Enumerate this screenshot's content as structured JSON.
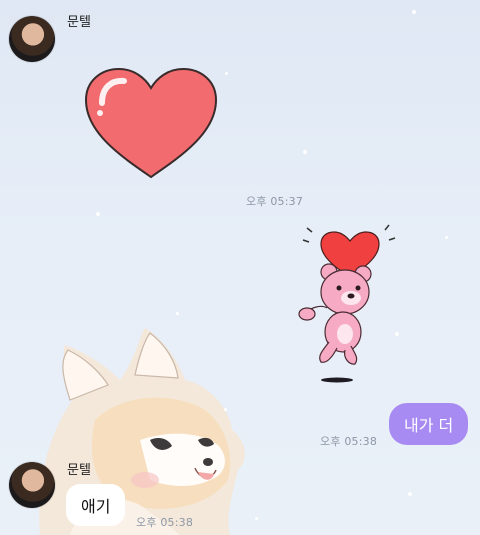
{
  "messages": [
    {
      "sender": "문텔",
      "type": "sticker",
      "sticker": "red-heart",
      "time": "오후 05:37"
    },
    {
      "sender": "me",
      "type": "sticker",
      "sticker": "pink-bear-holding-heart"
    },
    {
      "sender": "me",
      "type": "text",
      "text": "내가 더",
      "time": "오후 05:38"
    },
    {
      "sender": "문텔",
      "type": "text",
      "text": "애기",
      "time": "오후 05:38"
    }
  ],
  "colors": {
    "out_bubble": "#a78bf2",
    "in_bubble": "#ffffff",
    "timestamp": "#8d97a6"
  },
  "wallpaper": "snowy-sky-with-fox-illustration"
}
